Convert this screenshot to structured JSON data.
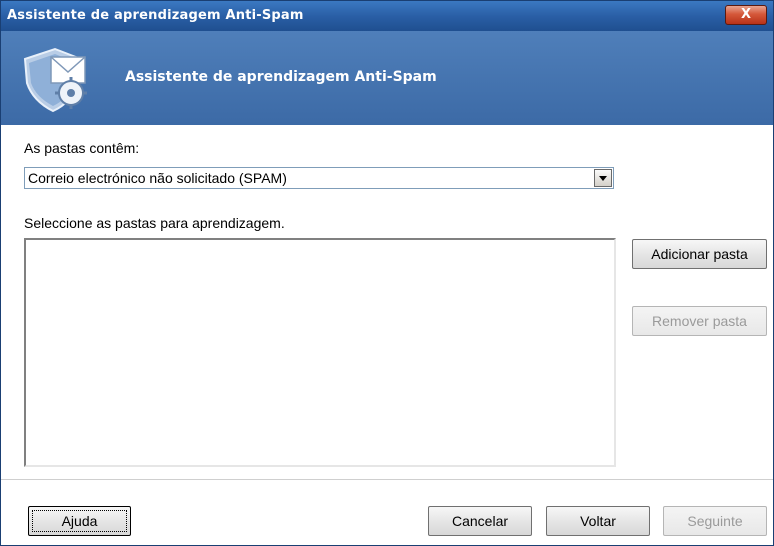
{
  "window": {
    "title": "Assistente de aprendizagem Anti-Spam",
    "close_label": "X"
  },
  "header": {
    "title": "Assistente de aprendizagem Anti-Spam",
    "logo_icon": "shield-envelope-gear-icon"
  },
  "form": {
    "folders_contain_label": "As pastas contêm:",
    "folders_contain_value": "Correio electrónico não solicitado (SPAM)",
    "select_folders_label": "Seleccione as pastas para aprendizagem."
  },
  "side_buttons": {
    "add_folder": "Adicionar pasta",
    "remove_folder": "Remover pasta"
  },
  "footer": {
    "help": "Ajuda",
    "cancel": "Cancelar",
    "back": "Voltar",
    "next": "Seguinte"
  },
  "colors": {
    "titlebar": "#2a5fa6",
    "header": "#4f7fba",
    "close": "#d5583a"
  }
}
